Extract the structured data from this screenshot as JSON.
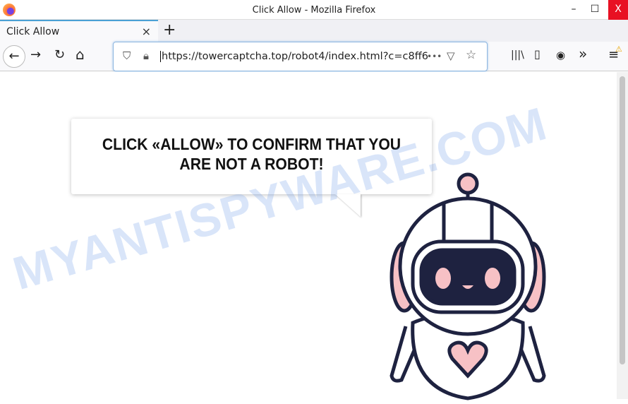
{
  "window": {
    "title": "Click Allow - Mozilla Firefox",
    "minimize": "–",
    "maximize": "☐",
    "close": "X"
  },
  "tab": {
    "label": "Click Allow",
    "close": "×",
    "new_tab": "+"
  },
  "nav": {
    "back": "←",
    "forward": "→",
    "reload": "↻",
    "home": "⌂",
    "url": "https://towercaptcha.top/robot4/index.html?c=c8ff6",
    "more": "•••",
    "library": "|||\\",
    "sidebar": "▯",
    "overflow": "»",
    "menu": "≡",
    "warning": "⚠"
  },
  "page": {
    "headline_line1": "CLICK «ALLOW» TO CONFIRM THAT YOU",
    "headline_line2": "ARE NOT A ROBOT!",
    "watermark": "MYANTISPYWARE.COM"
  },
  "colors": {
    "robot_outline": "#1e2240",
    "robot_pink": "#f7c1c5",
    "visor": "#1e2240",
    "close_button": "#e81123"
  }
}
